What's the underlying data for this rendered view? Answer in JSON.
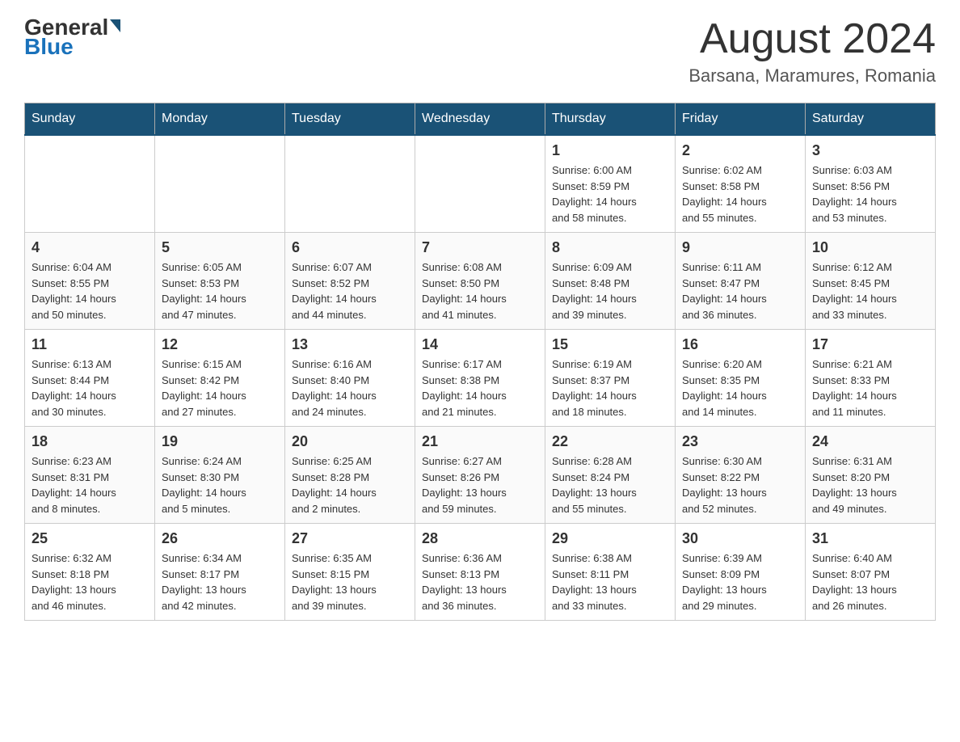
{
  "header": {
    "logo_general": "General",
    "logo_arrow": "▶",
    "logo_blue": "Blue",
    "month_year": "August 2024",
    "location": "Barsana, Maramures, Romania"
  },
  "days_of_week": [
    "Sunday",
    "Monday",
    "Tuesday",
    "Wednesday",
    "Thursday",
    "Friday",
    "Saturday"
  ],
  "weeks": [
    [
      {
        "day": "",
        "info": ""
      },
      {
        "day": "",
        "info": ""
      },
      {
        "day": "",
        "info": ""
      },
      {
        "day": "",
        "info": ""
      },
      {
        "day": "1",
        "info": "Sunrise: 6:00 AM\nSunset: 8:59 PM\nDaylight: 14 hours\nand 58 minutes."
      },
      {
        "day": "2",
        "info": "Sunrise: 6:02 AM\nSunset: 8:58 PM\nDaylight: 14 hours\nand 55 minutes."
      },
      {
        "day": "3",
        "info": "Sunrise: 6:03 AM\nSunset: 8:56 PM\nDaylight: 14 hours\nand 53 minutes."
      }
    ],
    [
      {
        "day": "4",
        "info": "Sunrise: 6:04 AM\nSunset: 8:55 PM\nDaylight: 14 hours\nand 50 minutes."
      },
      {
        "day": "5",
        "info": "Sunrise: 6:05 AM\nSunset: 8:53 PM\nDaylight: 14 hours\nand 47 minutes."
      },
      {
        "day": "6",
        "info": "Sunrise: 6:07 AM\nSunset: 8:52 PM\nDaylight: 14 hours\nand 44 minutes."
      },
      {
        "day": "7",
        "info": "Sunrise: 6:08 AM\nSunset: 8:50 PM\nDaylight: 14 hours\nand 41 minutes."
      },
      {
        "day": "8",
        "info": "Sunrise: 6:09 AM\nSunset: 8:48 PM\nDaylight: 14 hours\nand 39 minutes."
      },
      {
        "day": "9",
        "info": "Sunrise: 6:11 AM\nSunset: 8:47 PM\nDaylight: 14 hours\nand 36 minutes."
      },
      {
        "day": "10",
        "info": "Sunrise: 6:12 AM\nSunset: 8:45 PM\nDaylight: 14 hours\nand 33 minutes."
      }
    ],
    [
      {
        "day": "11",
        "info": "Sunrise: 6:13 AM\nSunset: 8:44 PM\nDaylight: 14 hours\nand 30 minutes."
      },
      {
        "day": "12",
        "info": "Sunrise: 6:15 AM\nSunset: 8:42 PM\nDaylight: 14 hours\nand 27 minutes."
      },
      {
        "day": "13",
        "info": "Sunrise: 6:16 AM\nSunset: 8:40 PM\nDaylight: 14 hours\nand 24 minutes."
      },
      {
        "day": "14",
        "info": "Sunrise: 6:17 AM\nSunset: 8:38 PM\nDaylight: 14 hours\nand 21 minutes."
      },
      {
        "day": "15",
        "info": "Sunrise: 6:19 AM\nSunset: 8:37 PM\nDaylight: 14 hours\nand 18 minutes."
      },
      {
        "day": "16",
        "info": "Sunrise: 6:20 AM\nSunset: 8:35 PM\nDaylight: 14 hours\nand 14 minutes."
      },
      {
        "day": "17",
        "info": "Sunrise: 6:21 AM\nSunset: 8:33 PM\nDaylight: 14 hours\nand 11 minutes."
      }
    ],
    [
      {
        "day": "18",
        "info": "Sunrise: 6:23 AM\nSunset: 8:31 PM\nDaylight: 14 hours\nand 8 minutes."
      },
      {
        "day": "19",
        "info": "Sunrise: 6:24 AM\nSunset: 8:30 PM\nDaylight: 14 hours\nand 5 minutes."
      },
      {
        "day": "20",
        "info": "Sunrise: 6:25 AM\nSunset: 8:28 PM\nDaylight: 14 hours\nand 2 minutes."
      },
      {
        "day": "21",
        "info": "Sunrise: 6:27 AM\nSunset: 8:26 PM\nDaylight: 13 hours\nand 59 minutes."
      },
      {
        "day": "22",
        "info": "Sunrise: 6:28 AM\nSunset: 8:24 PM\nDaylight: 13 hours\nand 55 minutes."
      },
      {
        "day": "23",
        "info": "Sunrise: 6:30 AM\nSunset: 8:22 PM\nDaylight: 13 hours\nand 52 minutes."
      },
      {
        "day": "24",
        "info": "Sunrise: 6:31 AM\nSunset: 8:20 PM\nDaylight: 13 hours\nand 49 minutes."
      }
    ],
    [
      {
        "day": "25",
        "info": "Sunrise: 6:32 AM\nSunset: 8:18 PM\nDaylight: 13 hours\nand 46 minutes."
      },
      {
        "day": "26",
        "info": "Sunrise: 6:34 AM\nSunset: 8:17 PM\nDaylight: 13 hours\nand 42 minutes."
      },
      {
        "day": "27",
        "info": "Sunrise: 6:35 AM\nSunset: 8:15 PM\nDaylight: 13 hours\nand 39 minutes."
      },
      {
        "day": "28",
        "info": "Sunrise: 6:36 AM\nSunset: 8:13 PM\nDaylight: 13 hours\nand 36 minutes."
      },
      {
        "day": "29",
        "info": "Sunrise: 6:38 AM\nSunset: 8:11 PM\nDaylight: 13 hours\nand 33 minutes."
      },
      {
        "day": "30",
        "info": "Sunrise: 6:39 AM\nSunset: 8:09 PM\nDaylight: 13 hours\nand 29 minutes."
      },
      {
        "day": "31",
        "info": "Sunrise: 6:40 AM\nSunset: 8:07 PM\nDaylight: 13 hours\nand 26 minutes."
      }
    ]
  ]
}
